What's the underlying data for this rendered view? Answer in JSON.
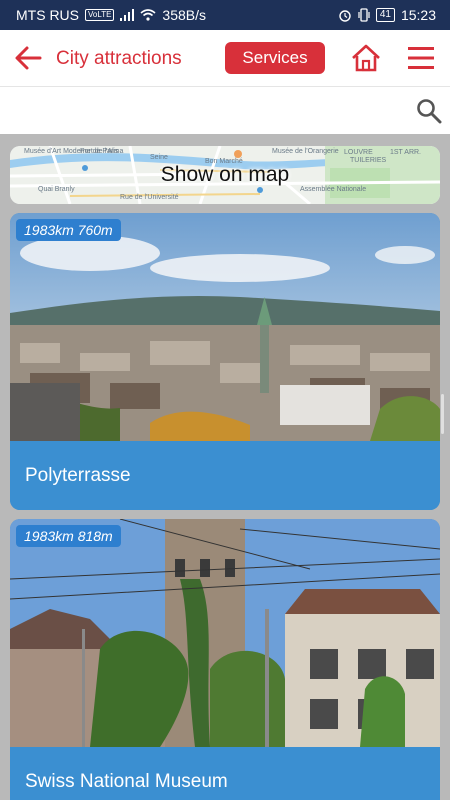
{
  "status_bar": {
    "carrier": "MTS RUS",
    "volte": "VoLTE",
    "net_speed": "358B/s",
    "battery": "41",
    "time": "15:23"
  },
  "app_bar": {
    "title": "City attractions",
    "services_label": "Services",
    "back_icon": "arrow-left-icon",
    "home_icon": "home-icon",
    "menu_icon": "hamburger-menu-icon",
    "accent_color": "#d8303a"
  },
  "search": {
    "value": "",
    "placeholder": "",
    "icon": "search-icon"
  },
  "map_card": {
    "label": "Show on map",
    "map_texts": [
      "Musée d'Art Moderne de Paris",
      "Port de l'Alma",
      "Seine",
      "LOUVRE",
      "1ST ARR.",
      "TUILERIES",
      "Bon Marché",
      "Quai Branly",
      "Rue de l'Université",
      "Assemblée Nationale",
      "Musée de l'Orangerie"
    ]
  },
  "attractions": [
    {
      "name": "Polyterrasse",
      "distance": "1983km 760m"
    },
    {
      "name": "Swiss National Museum",
      "distance": "1983km 818m"
    }
  ],
  "colors": {
    "status_bar": "#1e3158",
    "card_footer": "#3b8fd1",
    "badge": "#2e7fcf",
    "background": "#b9b9b9"
  }
}
